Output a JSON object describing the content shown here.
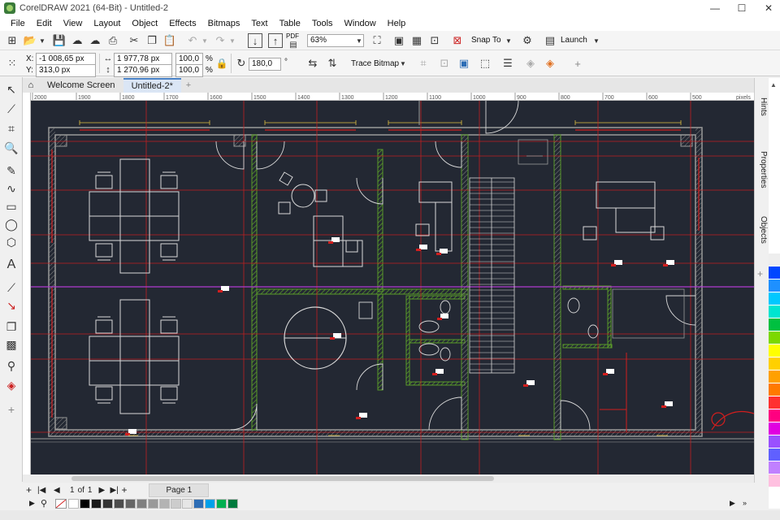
{
  "window": {
    "title": "CorelDRAW 2021 (64-Bit) - Untitled-2",
    "controls": {
      "minimize": "—",
      "maximize": "☐",
      "close": "✕"
    }
  },
  "menu": [
    "File",
    "Edit",
    "View",
    "Layout",
    "Object",
    "Effects",
    "Bitmaps",
    "Text",
    "Table",
    "Tools",
    "Window",
    "Help"
  ],
  "standard_toolbar": {
    "pdf_label": "PDF",
    "zoom_value": "63%",
    "snap_to_label": "Snap To",
    "launch_label": "Launch"
  },
  "property_bar": {
    "x_label": "X:",
    "x_value": "-1 008,65 px",
    "y_label": "Y:",
    "y_value": "313,0 px",
    "width_value": "1 977,78 px",
    "height_value": "1 270,96 px",
    "scale_w": "100,0",
    "scale_h": "100,0",
    "percent": "%",
    "rotation": "180,0",
    "degree": "°",
    "trace_bitmap_label": "Trace Bitmap"
  },
  "document_tabs": [
    {
      "label": "Welcome Screen",
      "active": false
    },
    {
      "label": "Untitled-2*",
      "active": true
    }
  ],
  "ruler": {
    "h_ticks": [
      "2000",
      "1900",
      "1800",
      "1700",
      "1600",
      "1500",
      "1400",
      "1300",
      "1200",
      "1100",
      "1000",
      "900",
      "800",
      "700",
      "600",
      "500"
    ],
    "unit": "pixels"
  },
  "page_nav": {
    "current": "1",
    "of_label": "of",
    "total": "1",
    "page_tab": "Page 1"
  },
  "dockers": {
    "hints": "Hints",
    "properties": "Properties",
    "objects": "Objects"
  },
  "colors": {
    "canvas_bg": "#232833",
    "wall": "#8a8a8a",
    "guide_red": "#d21e1e",
    "guide_purple": "#b03ad0",
    "hatch_green": "#5a9a2a",
    "accent_blue": "#4a82c6"
  },
  "palette_colors": [
    "#ffffff",
    "#000000",
    "#1a1a1a",
    "#333333",
    "#4d4d4d",
    "#666666",
    "#808080",
    "#999999",
    "#b3b3b3",
    "#cccccc",
    "#e6e6e6",
    "#2d6db5",
    "#00a0e9",
    "#00b050",
    "#007a3d"
  ],
  "vertical_palette": [
    "#ffffff",
    "#eeeeee",
    "#0047ff",
    "#1e90ff",
    "#00c8ff",
    "#00e5d0",
    "#00c040",
    "#7cd800",
    "#ffff00",
    "#ffd000",
    "#ffa000",
    "#ff7a00",
    "#ff3030",
    "#ff0080",
    "#e000e0",
    "#9a50ff",
    "#6060ff",
    "#c080ff",
    "#ffc0e0"
  ]
}
